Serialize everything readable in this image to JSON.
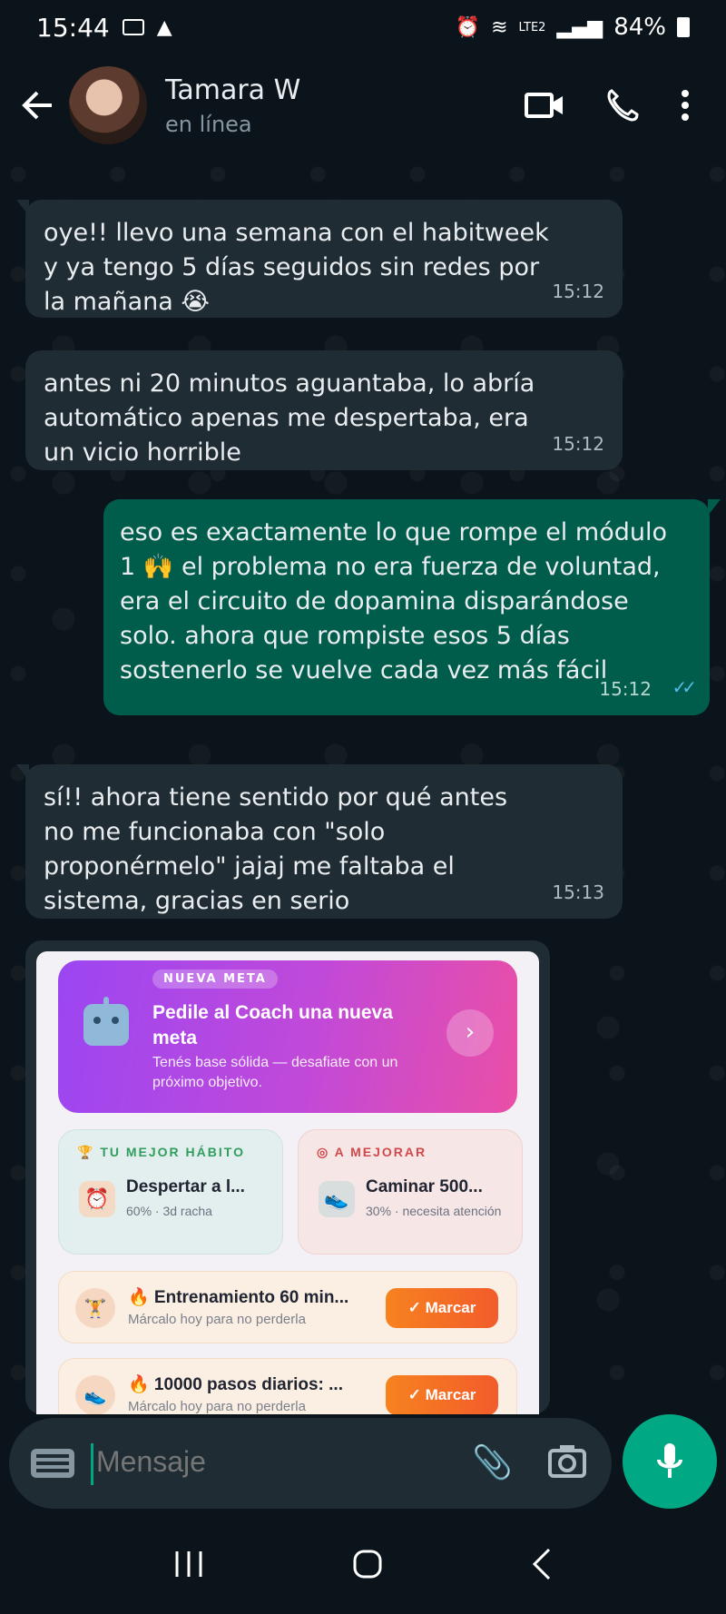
{
  "status_bar": {
    "time": "15:44",
    "battery": "84%",
    "network": "LTE2"
  },
  "header": {
    "contact_name": "Tamara W",
    "contact_status": "en línea"
  },
  "messages": [
    {
      "direction": "in",
      "text": "oye!! llevo una semana con el habitweek y ya tengo 5 días seguidos sin redes por la mañana 😭",
      "time": "15:12"
    },
    {
      "direction": "in",
      "text": "antes ni 20 minutos aguantaba, lo abría automático apenas me despertaba, era un vicio horrible",
      "time": "15:12"
    },
    {
      "direction": "out",
      "text": "eso es exactamente lo que rompe el módulo 1 🙌 el problema no era fuerza de voluntad, era el circuito de dopamina disparándose solo. ahora que rompiste esos 5 días sostenerlo se vuelve cada vez más fácil",
      "time": "15:12",
      "status": "read"
    },
    {
      "direction": "in",
      "text": "sí!! ahora tiene sentido por qué antes no me funcionaba con \"solo proponérmelo\" jajaj me faltaba el sistema, gracias en serio",
      "time": "15:13"
    }
  ],
  "shared_image": {
    "goal_card": {
      "tag": "NUEVA META",
      "title": "Pedile al Coach una nueva meta",
      "subtitle": "Tenés base sólida — desafiate con un próximo objetivo."
    },
    "best_habit": {
      "heading": "TU MEJOR HÁBITO",
      "title": "Despertar a l...",
      "meta": "60% · 3d racha"
    },
    "to_improve": {
      "heading": "A MEJORAR",
      "title": "Caminar 500...",
      "meta": "30% · necesita atención"
    },
    "tasks": [
      {
        "title": "🔥 Entrenamiento 60 min...",
        "subtitle": "Márcalo hoy para no perderla",
        "button": "✓ Marcar"
      },
      {
        "title": "🔥 10000 pasos diarios: ...",
        "subtitle": "Márcalo hoy para no perderla",
        "button": "✓ Marcar"
      }
    ]
  },
  "composer": {
    "placeholder": "Mensaje"
  },
  "colors": {
    "background": "#0b141a",
    "incoming_bubble": "#202c33",
    "outgoing_bubble": "#005c4b",
    "accent": "#00a884",
    "read_ticks": "#53bdeb"
  }
}
